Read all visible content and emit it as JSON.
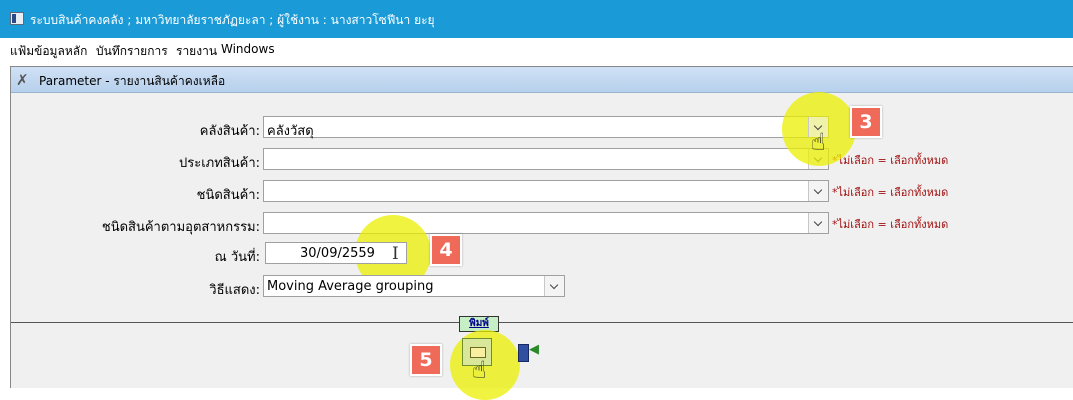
{
  "window": {
    "title": "ระบบสินค้าคงคลัง ; มหาวิทยาลัยราชภัฏยะลา ; ผู้ใช้งาน : นางสาวโซฟีนา ยะยุ"
  },
  "menu": {
    "items": [
      "แฟ้มข้อมูลหลัก",
      "บันทึกรายการ",
      "รายงาน",
      "Windows"
    ]
  },
  "child_window": {
    "title": "Parameter - รายงานสินค้าคงเหลือ",
    "icon": "tools-icon"
  },
  "form": {
    "warehouse": {
      "label": "คลังสินค้า:",
      "value": "คลังวัสดุ"
    },
    "product_type": {
      "label": "ประเภทสินค้า:",
      "value": "",
      "note": "*ไม่เลือก = เลือกทั้งหมด"
    },
    "product_kind": {
      "label": "ชนิดสินค้า:",
      "value": "",
      "note": "*ไม่เลือก = เลือกทั้งหมด"
    },
    "industry_kind": {
      "label": "ชนิดสินค้าตามอุตสาหกรรม:",
      "value": "",
      "note": "*ไม่เลือก = เลือกทั้งหมด"
    },
    "as_of_date": {
      "label": "ณ วันที่:",
      "value": "30/09/2559"
    },
    "display_method": {
      "label": "วิธีแสดง:",
      "value": "Moving Average grouping"
    }
  },
  "actions": {
    "print_label": "พิมพ์"
  },
  "annotations": {
    "step3": "3",
    "step4": "4",
    "step5": "5",
    "highlight_color": "#ebf000",
    "badge_color": "#f06a5a"
  }
}
